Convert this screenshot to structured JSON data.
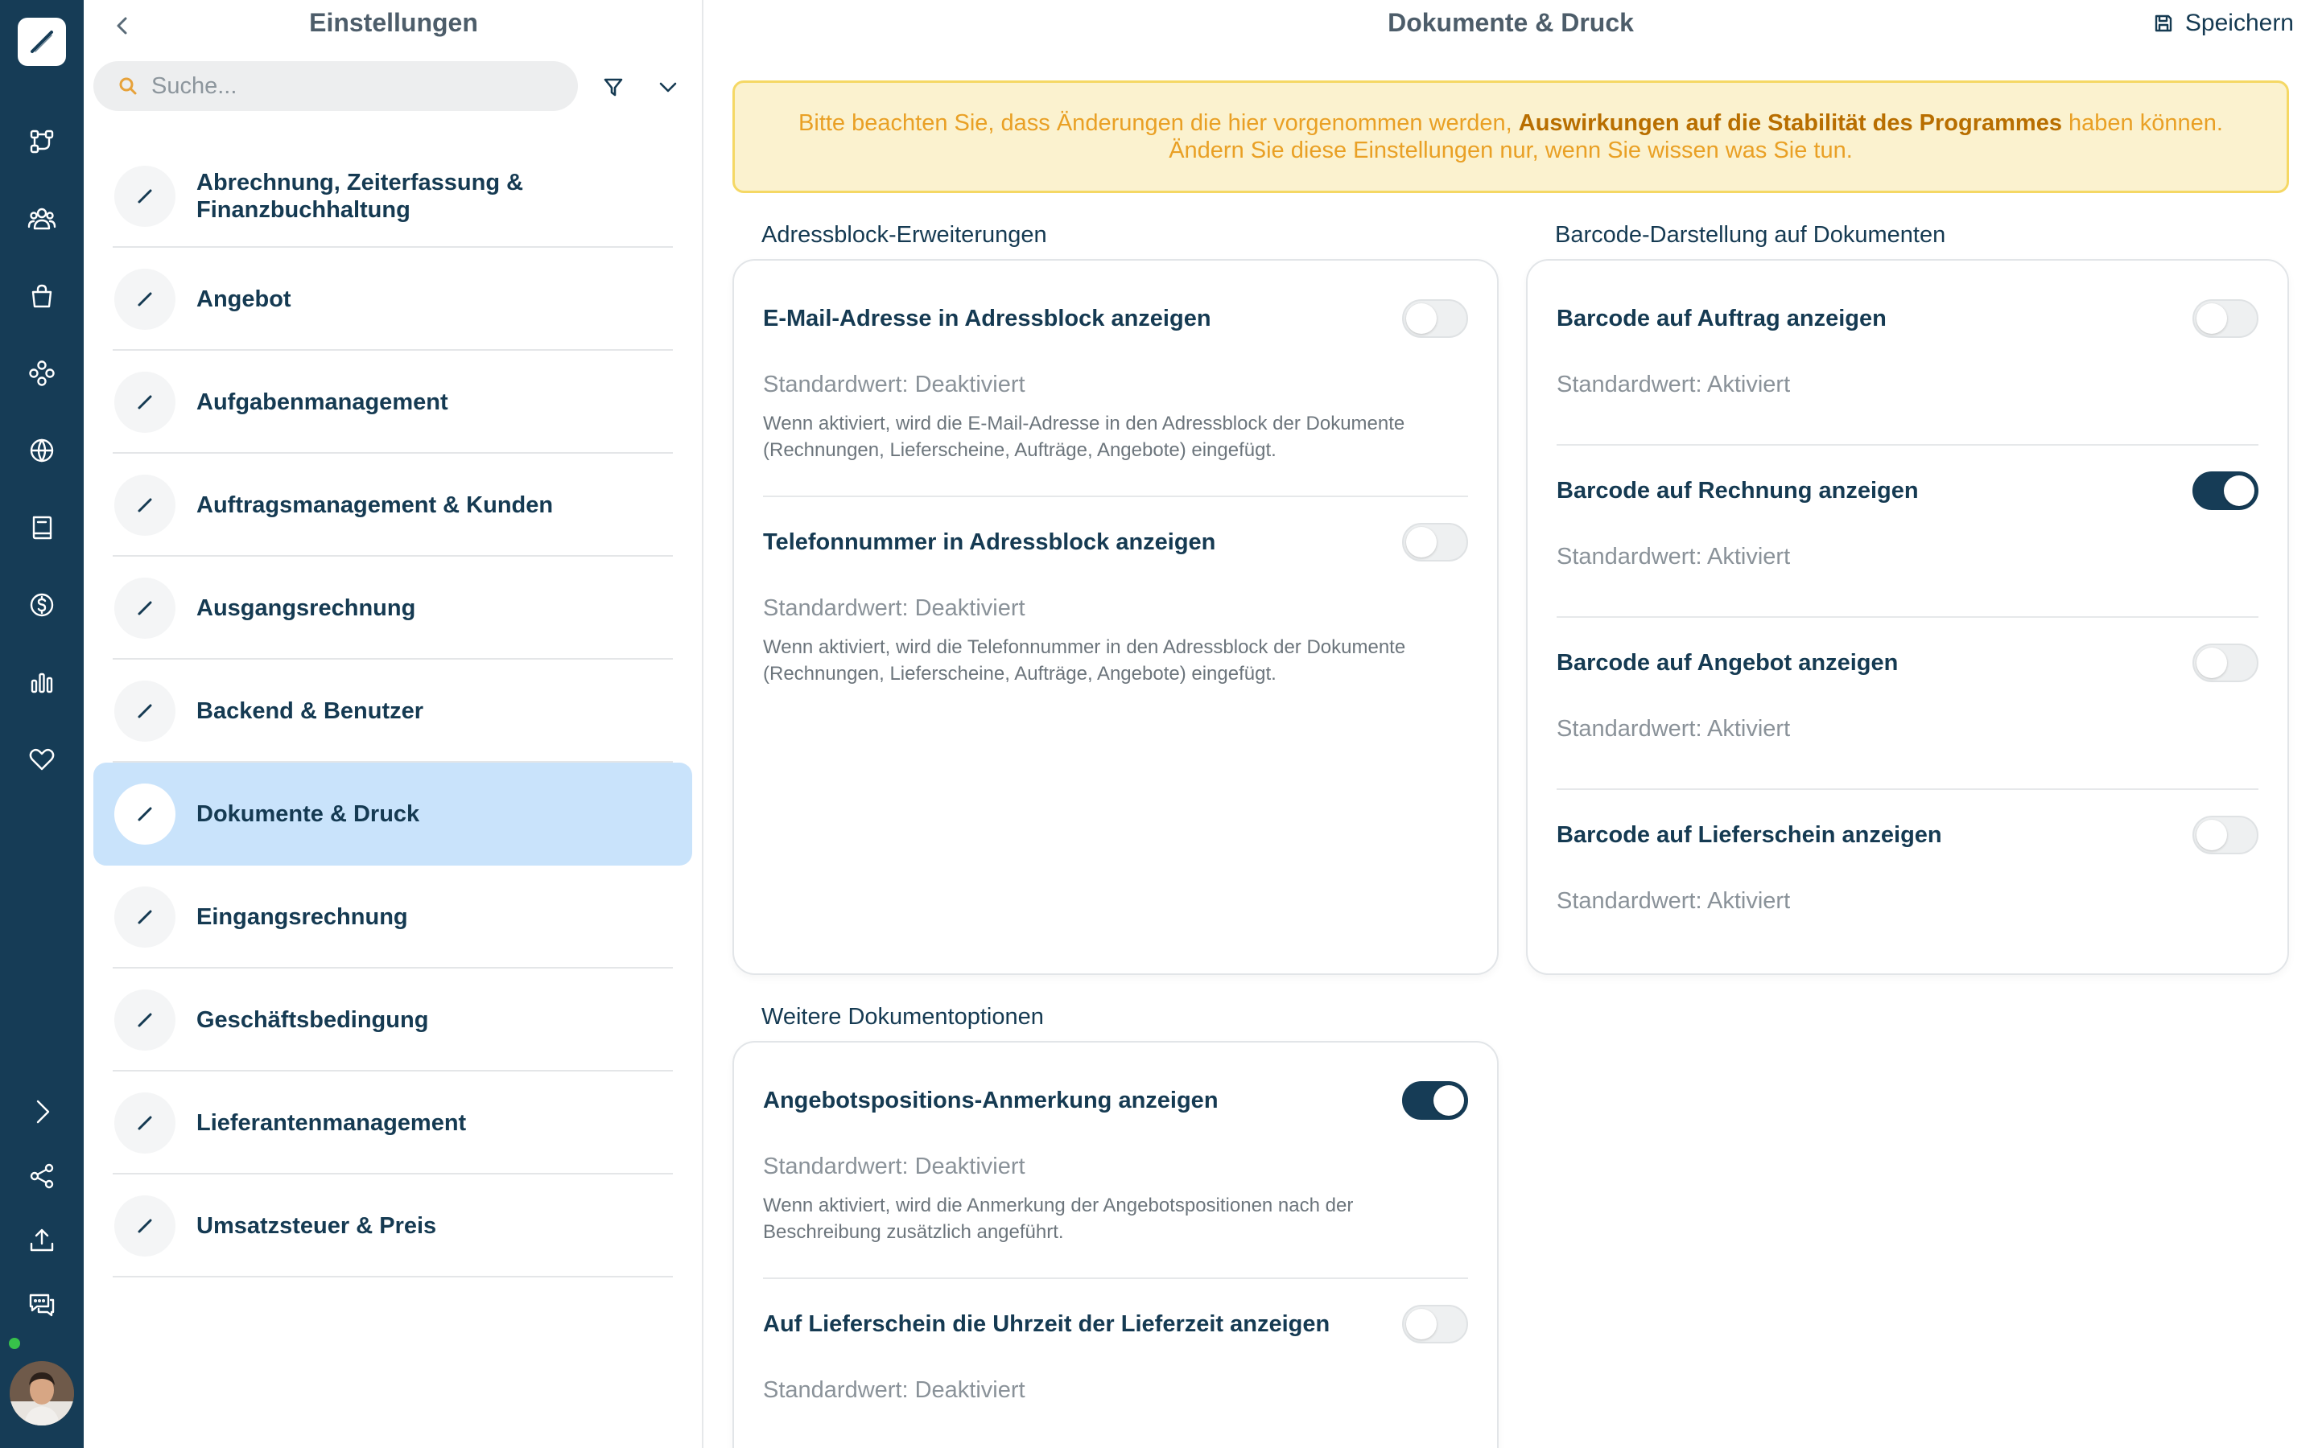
{
  "rail": {
    "items": [
      {
        "name": "workflow-icon"
      },
      {
        "name": "users-icon"
      },
      {
        "name": "shopping-bag-icon"
      },
      {
        "name": "modules-icon"
      },
      {
        "name": "globe-icon"
      },
      {
        "name": "book-icon"
      },
      {
        "name": "dollar-icon"
      },
      {
        "name": "bar-chart-icon"
      },
      {
        "name": "heart-icon"
      }
    ],
    "bottom": [
      {
        "name": "expand-icon"
      },
      {
        "name": "share-icon"
      },
      {
        "name": "upload-icon"
      },
      {
        "name": "chat-icon"
      }
    ],
    "status_color": "#37c24a"
  },
  "list": {
    "title": "Einstellungen",
    "search_placeholder": "Suche...",
    "categories": [
      {
        "label": "Abrechnung, Zeiterfassung & Finanzbuchhaltung",
        "active": false
      },
      {
        "label": "Angebot",
        "active": false
      },
      {
        "label": "Aufgabenmanagement",
        "active": false
      },
      {
        "label": "Auftragsmanagement & Kunden",
        "active": false
      },
      {
        "label": "Ausgangsrechnung",
        "active": false
      },
      {
        "label": "Backend & Benutzer",
        "active": false
      },
      {
        "label": "Dokumente & Druck",
        "active": true
      },
      {
        "label": "Eingangsrechnung",
        "active": false
      },
      {
        "label": "Geschäftsbedingung",
        "active": false
      },
      {
        "label": "Lieferantenmanagement",
        "active": false
      },
      {
        "label": "Umsatzsteuer & Preis",
        "active": false
      }
    ]
  },
  "main": {
    "title": "Dokumente & Druck",
    "save_label": "Speichern",
    "warning": {
      "line1_before": "Bitte beachten Sie, dass Änderungen die hier vorgenommen werden, ",
      "line1_bold": "Auswirkungen auf die Stabilität des Programmes",
      "line1_after": " haben können.",
      "line2": "Ändern Sie diese Einstellungen nur, wenn Sie wissen was Sie tun."
    },
    "sections": {
      "address": {
        "title": "Adressblock-Erweiterungen",
        "settings": [
          {
            "label": "E-Mail-Adresse in Adressblock anzeigen",
            "default": "Standardwert: Deaktiviert",
            "desc_line1": "Wenn aktiviert, wird die E-Mail-Adresse in den Adressblock der Dokumente",
            "desc_line2": "(Rechnungen, Lieferscheine, Aufträge, Angebote) eingefügt.",
            "on": false
          },
          {
            "label": "Telefonnummer in Adressblock anzeigen",
            "default": "Standardwert: Deaktiviert",
            "desc_line1": "Wenn aktiviert, wird die Telefonnummer in den Adressblock der Dokumente",
            "desc_line2": "(Rechnungen, Lieferscheine, Aufträge, Angebote) eingefügt.",
            "on": false
          }
        ]
      },
      "barcode": {
        "title": "Barcode-Darstellung auf Dokumenten",
        "settings": [
          {
            "label": "Barcode auf Auftrag anzeigen",
            "default": "Standardwert: Aktiviert",
            "on": false
          },
          {
            "label": "Barcode auf Rechnung anzeigen",
            "default": "Standardwert: Aktiviert",
            "on": true
          },
          {
            "label": "Barcode auf Angebot anzeigen",
            "default": "Standardwert: Aktiviert",
            "on": false
          },
          {
            "label": "Barcode auf Lieferschein anzeigen",
            "default": "Standardwert: Aktiviert",
            "on": false
          }
        ]
      },
      "more": {
        "title": "Weitere Dokumentoptionen",
        "settings": [
          {
            "label": "Angebotspositions-Anmerkung anzeigen",
            "default": "Standardwert: Deaktiviert",
            "desc_line1": "Wenn aktiviert, wird die Anmerkung der Angebotspositionen nach der",
            "desc_line2": "Beschreibung zusätzlich angeführt.",
            "on": true
          },
          {
            "label": "Auf Lieferschein die Uhrzeit der Lieferzeit anzeigen",
            "default": "Standardwert: Deaktiviert",
            "on": false
          }
        ]
      }
    }
  }
}
